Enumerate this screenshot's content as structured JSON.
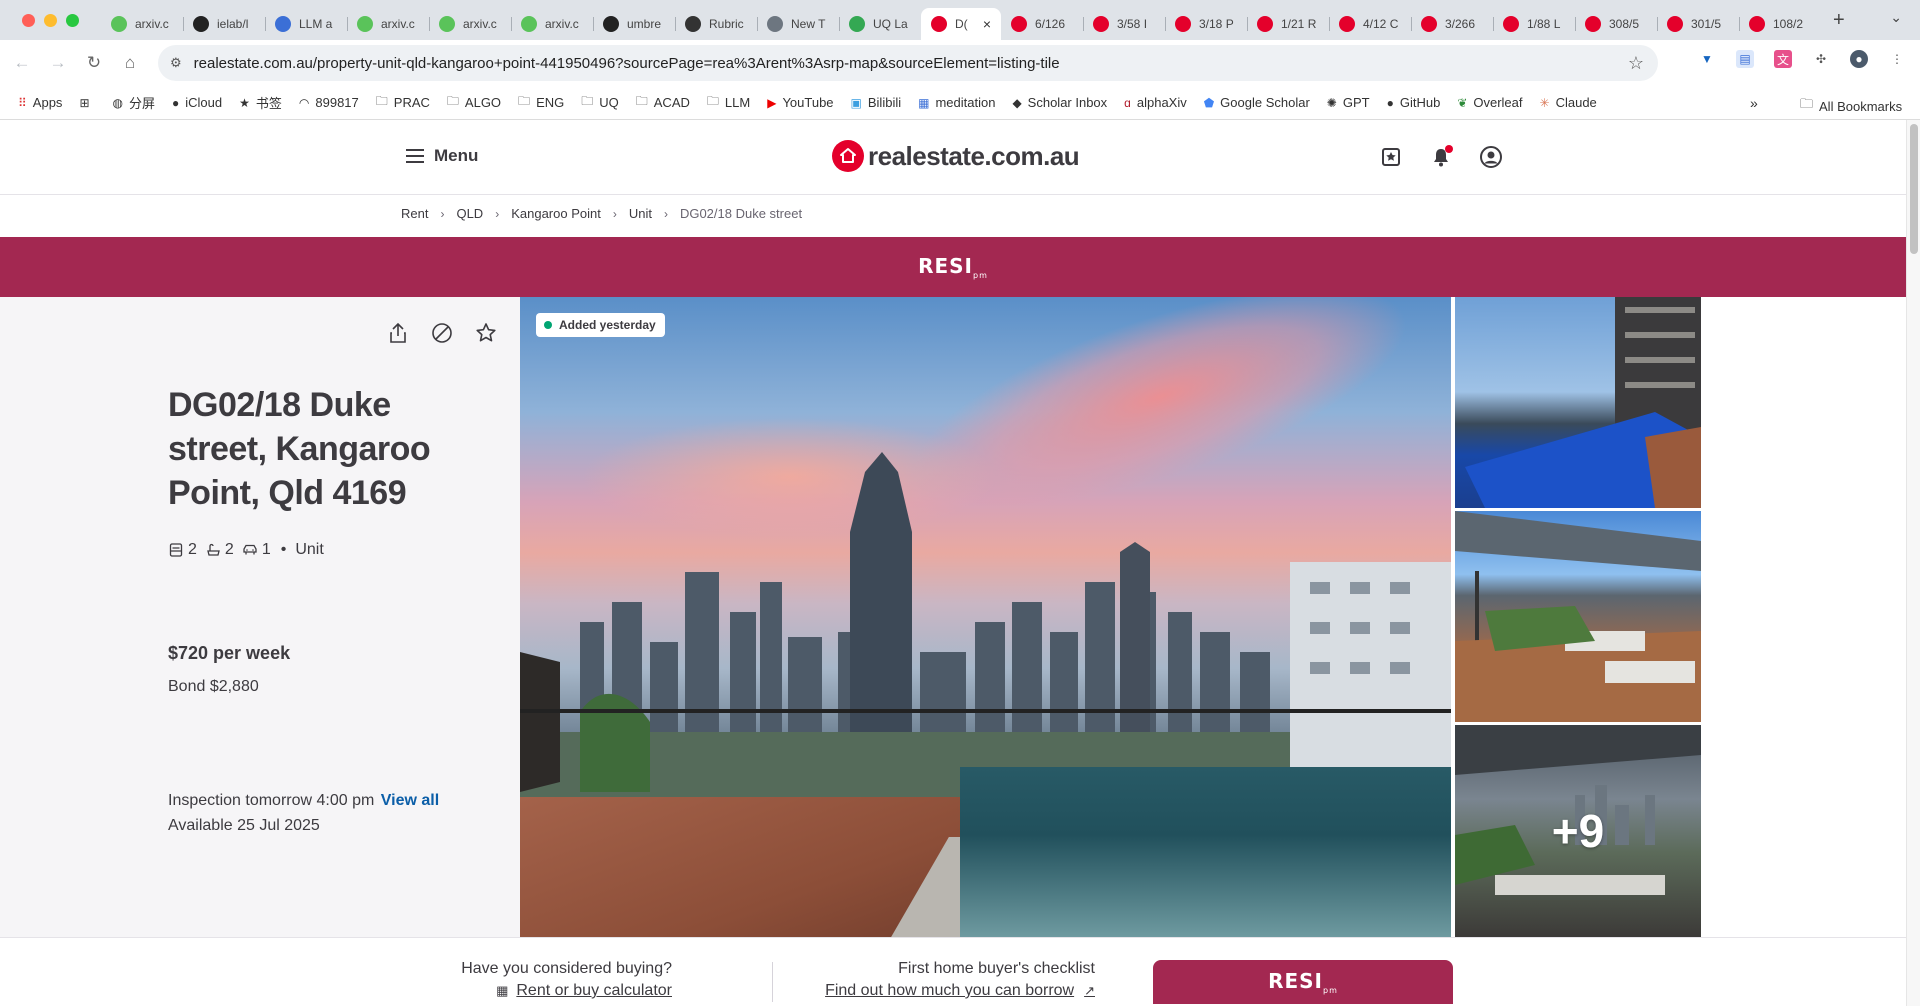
{
  "browser": {
    "tabs": [
      {
        "label": "arxiv.c",
        "favicon": "green"
      },
      {
        "label": "ielab/l",
        "favicon": "github"
      },
      {
        "label": "LLM a",
        "favicon": "blue"
      },
      {
        "label": "arxiv.c",
        "favicon": "green"
      },
      {
        "label": "arxiv.c",
        "favicon": "green"
      },
      {
        "label": "arxiv.c",
        "favicon": "green"
      },
      {
        "label": "umbre",
        "favicon": "github"
      },
      {
        "label": "Rubric",
        "favicon": "rubric"
      },
      {
        "label": "New T",
        "favicon": "globe"
      },
      {
        "label": "UQ La",
        "favicon": "map"
      },
      {
        "label": "D(",
        "favicon": "rea",
        "active": true
      },
      {
        "label": "6/126",
        "favicon": "rea"
      },
      {
        "label": "3/58 I",
        "favicon": "rea"
      },
      {
        "label": "3/18 P",
        "favicon": "rea"
      },
      {
        "label": "1/21 R",
        "favicon": "rea"
      },
      {
        "label": "4/12 C",
        "favicon": "rea"
      },
      {
        "label": "3/266",
        "favicon": "rea"
      },
      {
        "label": "1/88 L",
        "favicon": "rea"
      },
      {
        "label": "308/5",
        "favicon": "rea"
      },
      {
        "label": "301/5",
        "favicon": "rea"
      },
      {
        "label": "108/2",
        "favicon": "rea"
      }
    ],
    "new_tab": "+",
    "url": "realestate.com.au/property-unit-qld-kangaroo+point-441950496?sourcePage=rea%3Arent%3Asrp-map&sourceElement=listing-tile",
    "bookmarks": [
      {
        "label": "Apps",
        "icon": "apps-grid-icon"
      },
      {
        "label": "",
        "icon": "grid-icon"
      },
      {
        "label": "分屏",
        "icon": "globe-icon"
      },
      {
        "label": "iCloud",
        "icon": "apple-icon"
      },
      {
        "label": "书签",
        "icon": "star-icon"
      },
      {
        "label": "899817",
        "icon": "wifi-icon"
      },
      {
        "label": "PRAC",
        "icon": "folder-icon"
      },
      {
        "label": "ALGO",
        "icon": "folder-icon"
      },
      {
        "label": "ENG",
        "icon": "folder-icon"
      },
      {
        "label": "UQ",
        "icon": "folder-icon"
      },
      {
        "label": "ACAD",
        "icon": "folder-icon"
      },
      {
        "label": "LLM",
        "icon": "folder-icon"
      },
      {
        "label": "YouTube",
        "icon": "youtube-icon"
      },
      {
        "label": "Bilibili",
        "icon": "bilibili-icon"
      },
      {
        "label": "meditation",
        "icon": "calendar-icon"
      },
      {
        "label": "Scholar Inbox",
        "icon": "scholar-inbox-icon"
      },
      {
        "label": "alphaXiv",
        "icon": "alphaxiv-icon"
      },
      {
        "label": "Google Scholar",
        "icon": "google-scholar-icon"
      },
      {
        "label": "GPT",
        "icon": "openai-icon"
      },
      {
        "label": "GitHub",
        "icon": "github-icon"
      },
      {
        "label": "Overleaf",
        "icon": "overleaf-icon"
      },
      {
        "label": "Claude",
        "icon": "claude-icon"
      }
    ],
    "bookmarks_more": "»",
    "all_bookmarks": "All Bookmarks"
  },
  "site": {
    "menu_label": "Menu",
    "logo_text": "realestate.com.au",
    "brand_color": "#e4002b",
    "agency_color": "#a32851"
  },
  "breadcrumb": [
    "Rent",
    "QLD",
    "Kangaroo Point",
    "Unit",
    "DG02/18 Duke street"
  ],
  "agency": {
    "name": "RESI",
    "suffix": "pm"
  },
  "listing": {
    "address": "DG02/18 Duke street, Kangaroo Point, Qld 4169",
    "bedrooms": "2",
    "bathrooms": "2",
    "parking": "1",
    "property_type": "Unit",
    "price": "$720 per week",
    "bond": "Bond $2,880",
    "inspection": "Inspection tomorrow 4:00 pm",
    "view_all": "View all",
    "available": "Available 25 Jul 2025",
    "added_badge": "Added yesterday",
    "more_photos": "+9"
  },
  "bottom": {
    "q1": "Have you considered buying?",
    "link1": "Rent or buy calculator",
    "q2": "First home buyer's checklist",
    "link2": "Find out how much you can borrow"
  }
}
